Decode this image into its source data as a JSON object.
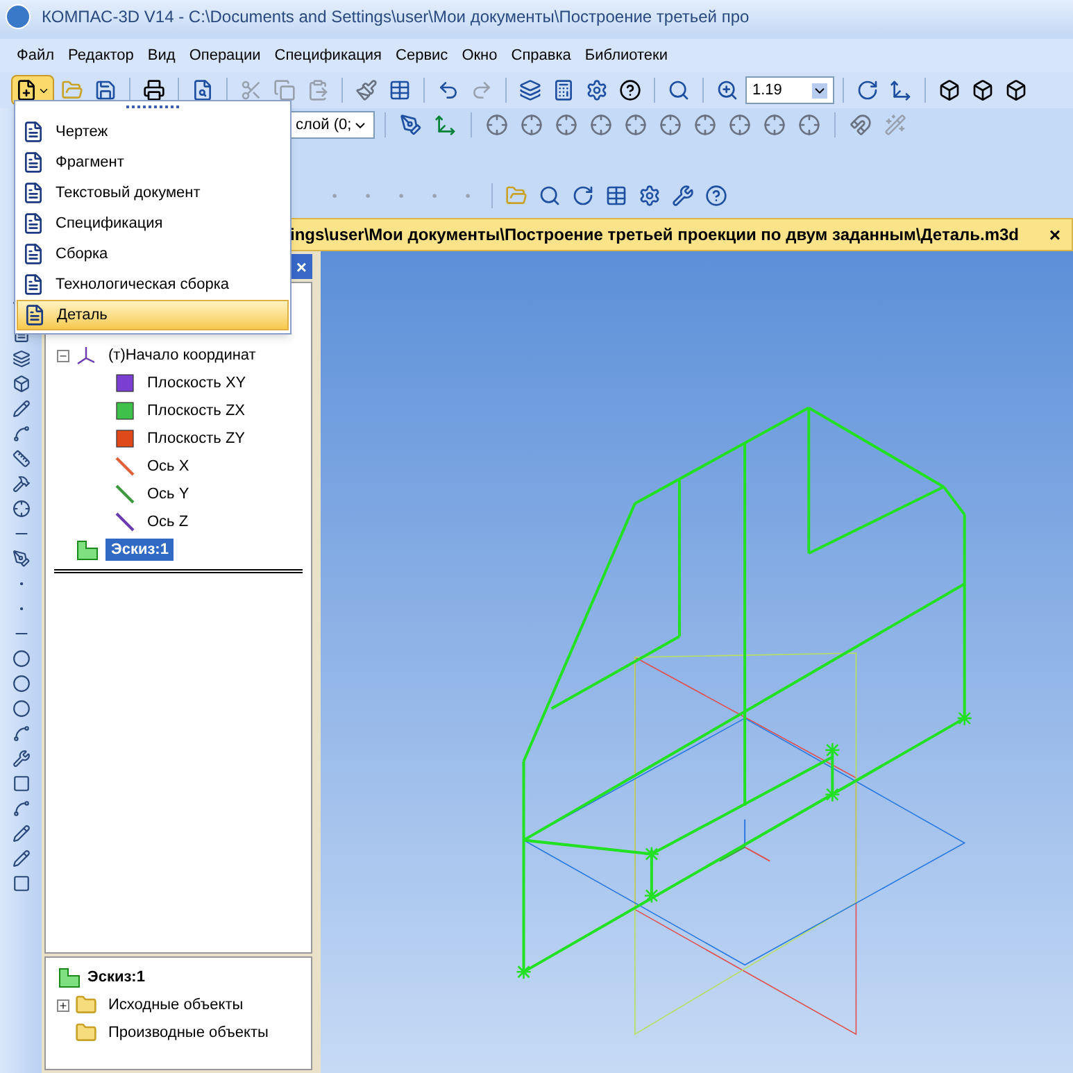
{
  "window": {
    "title": "КОМПАС-3D V14 - C:\\Documents and Settings\\user\\Мои документы\\Построение третьей про"
  },
  "menu": [
    "Файл",
    "Редактор",
    "Вид",
    "Операции",
    "Спецификация",
    "Сервис",
    "Окно",
    "Справка",
    "Библиотеки"
  ],
  "toolbar": {
    "zoom_value": "1.19",
    "layer_value": "слой (0;"
  },
  "new_menu": [
    {
      "label": "Чертеж",
      "selected": false
    },
    {
      "label": "Фрагмент",
      "selected": false
    },
    {
      "label": "Текстовый документ",
      "selected": false
    },
    {
      "label": "Спецификация",
      "selected": false
    },
    {
      "label": "Сборка",
      "selected": false
    },
    {
      "label": "Технологическая сборка",
      "selected": false
    },
    {
      "label": "Деталь",
      "selected": true
    }
  ],
  "document_tab": {
    "path": "ings\\user\\Мои документы\\Построение третьей проекции по двум заданным\\Деталь.m3d",
    "close": "×"
  },
  "tree_panel": {
    "close": "×",
    "items": [
      {
        "label": "(т)Начало координат",
        "kind": "origin",
        "expanded": true,
        "selected": false,
        "children": [
          {
            "label": "Плоскость XY",
            "kind": "plane",
            "color": "#7a3fd0",
            "selected": false
          },
          {
            "label": "Плоскость ZX",
            "kind": "plane",
            "color": "#3fc04a",
            "selected": false
          },
          {
            "label": "Плоскость ZY",
            "kind": "plane",
            "color": "#e04a1a",
            "selected": false
          },
          {
            "label": "Ось X",
            "kind": "axis",
            "color": "#e0603a",
            "selected": false
          },
          {
            "label": "Ось Y",
            "kind": "axis",
            "color": "#3a9a3a",
            "selected": false
          },
          {
            "label": "Ось Z",
            "kind": "axis",
            "color": "#6a3ab0",
            "selected": false
          }
        ]
      },
      {
        "label": "Эскиз:1",
        "kind": "sketch",
        "selected": true
      }
    ]
  },
  "sketch_panel": {
    "title": "Эскиз:1",
    "items": [
      {
        "label": "Исходные объекты",
        "kind": "folder",
        "expanded": false
      },
      {
        "label": "Производные объекты",
        "kind": "folder"
      }
    ]
  }
}
